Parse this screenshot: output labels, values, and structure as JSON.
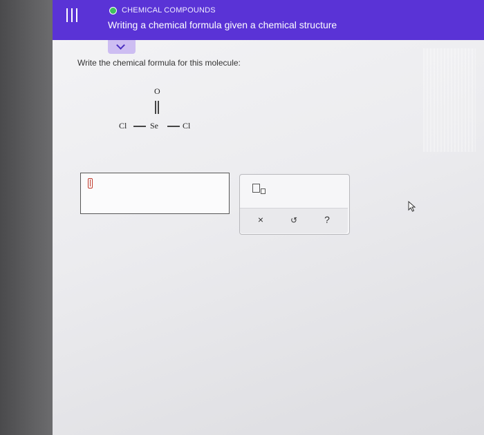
{
  "header": {
    "topic": "CHEMICAL COMPOUNDS",
    "title": "Writing a chemical formula given a chemical structure",
    "accent_color": "#5a33d6",
    "status_dot_color": "#3fbf5f"
  },
  "icons": {
    "menu": "menu-icon",
    "collapse": "chevron-down-icon",
    "subscript": "subscript-icon",
    "clear": "close-icon",
    "undo": "undo-icon",
    "help": "help-icon"
  },
  "question": {
    "prompt": "Write the chemical formula for this molecule:"
  },
  "molecule": {
    "top_atom": "O",
    "left_atom": "Cl",
    "center_atom": "Se",
    "right_atom": "Cl"
  },
  "answer": {
    "value": ""
  },
  "toolbar": {
    "clear_label": "×",
    "undo_label": "↺",
    "help_label": "?"
  }
}
